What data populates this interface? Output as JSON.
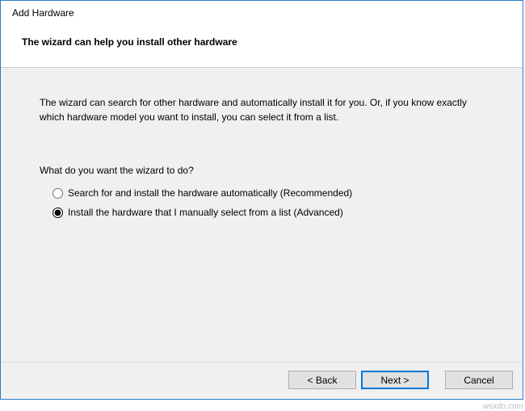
{
  "header": {
    "title": "Add Hardware",
    "subtitle": "The wizard can help you install other hardware"
  },
  "content": {
    "description": "The wizard can search for other hardware and automatically install it for you. Or, if you know exactly which hardware model you want to install, you can select it from a list.",
    "question": "What do you want the wizard to do?",
    "options": [
      {
        "label": "Search for and install the hardware automatically (Recommended)",
        "selected": false
      },
      {
        "label": "Install the hardware that I manually select from a list (Advanced)",
        "selected": true
      }
    ]
  },
  "buttons": {
    "back": "< Back",
    "next": "Next >",
    "cancel": "Cancel"
  },
  "watermark": "wsxdn.com"
}
